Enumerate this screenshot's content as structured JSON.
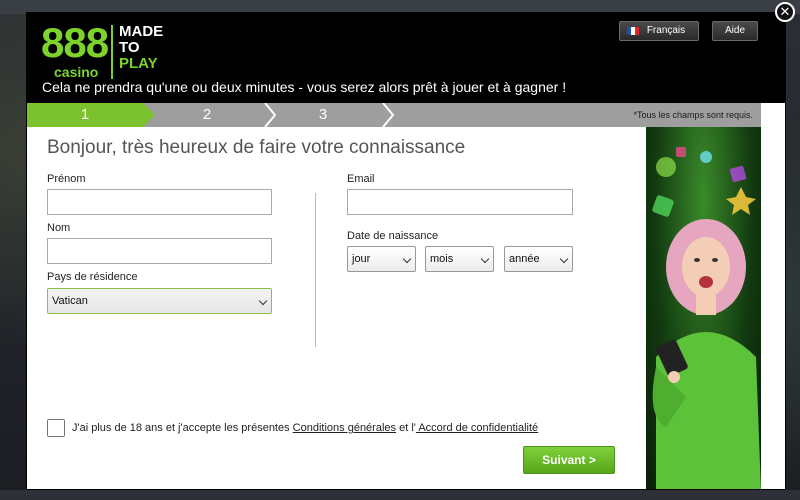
{
  "header": {
    "logo": {
      "number": "888",
      "brand": "casino",
      "slogan_line1": "MADE",
      "slogan_line2": "TO",
      "slogan_line3": "PLAY"
    },
    "tagline": "Cela ne prendra qu'une ou deux minutes - vous serez alors prêt à jouer et à gagner !",
    "language_label": "Français",
    "help_label": "Aide"
  },
  "steps": {
    "items": [
      "1",
      "2",
      "3"
    ],
    "active": "1",
    "required_note": "*Tous les champs sont requis."
  },
  "form": {
    "title": "Bonjour, très heureux de faire votre connaissance",
    "first_name": {
      "label": "Prénom",
      "value": ""
    },
    "last_name": {
      "label": "Nom",
      "value": ""
    },
    "country": {
      "label": "Pays de résidence",
      "value": "Vatican"
    },
    "email": {
      "label": "Email",
      "value": ""
    },
    "birthdate": {
      "label": "Date de naissance",
      "day": "jour",
      "month": "mois",
      "year": "année"
    },
    "terms": {
      "text_before": "J'ai plus de 18 ans et j'accepte les présentes ",
      "link1": "Conditions générales",
      "text_mid": " et l'",
      "link2": " Accord de confidentialité",
      "checked": false
    },
    "next_label": "Suivant >"
  },
  "colors": {
    "brand_green": "#7bd32b",
    "step_active": "#7cc22e",
    "step_inactive": "#9e9e9e",
    "button_green": "#63b223"
  },
  "icons": {
    "close": "close-icon",
    "flag": "france-flag-icon",
    "dropdown": "chevron-down-icon"
  }
}
